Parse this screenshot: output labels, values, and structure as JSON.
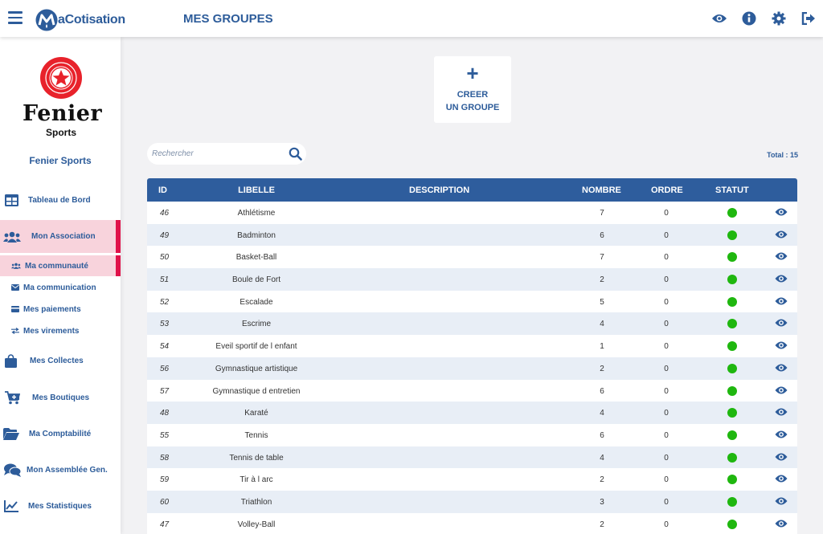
{
  "app": {
    "brand": "aCotisation",
    "brand_initial": "M"
  },
  "header": {
    "title": "MES GROUPES"
  },
  "org": {
    "name": "Fenier Sports",
    "logo_line1": "Fenier",
    "logo_line2": "Sports"
  },
  "sidebar": {
    "items": [
      {
        "label": "Tableau de Bord"
      },
      {
        "label": "Mon Association"
      },
      {
        "label": "Ma communauté"
      },
      {
        "label": "Ma communication"
      },
      {
        "label": "Mes paiements"
      },
      {
        "label": "Mes virements"
      },
      {
        "label": "Mes Collectes"
      },
      {
        "label": "Mes Boutiques"
      },
      {
        "label": "Ma Comptabilité"
      },
      {
        "label": "Mon Assemblée Gen."
      },
      {
        "label": "Mes Statistiques"
      }
    ]
  },
  "create": {
    "plus": "+",
    "line1": "CREER",
    "line2": "UN GROUPE"
  },
  "search": {
    "placeholder": "Rechercher",
    "value": ""
  },
  "total": "Total : 15",
  "table": {
    "headers": {
      "id": "ID",
      "libelle": "LIBELLE",
      "description": "DESCRIPTION",
      "nombre": "NOMBRE",
      "ordre": "ORDRE",
      "statut": "STATUT"
    },
    "rows": [
      {
        "id": "46",
        "libelle": "Athlétisme",
        "nombre": "7",
        "ordre": "0"
      },
      {
        "id": "49",
        "libelle": "Badminton",
        "nombre": "6",
        "ordre": "0"
      },
      {
        "id": "50",
        "libelle": "Basket-Ball",
        "nombre": "7",
        "ordre": "0"
      },
      {
        "id": "51",
        "libelle": "Boule de Fort",
        "nombre": "2",
        "ordre": "0"
      },
      {
        "id": "52",
        "libelle": "Escalade",
        "nombre": "5",
        "ordre": "0"
      },
      {
        "id": "53",
        "libelle": "Escrime",
        "nombre": "4",
        "ordre": "0"
      },
      {
        "id": "54",
        "libelle": "Eveil sportif de l enfant",
        "nombre": "1",
        "ordre": "0"
      },
      {
        "id": "56",
        "libelle": "Gymnastique artistique",
        "nombre": "2",
        "ordre": "0"
      },
      {
        "id": "57",
        "libelle": "Gymnastique d entretien",
        "nombre": "6",
        "ordre": "0"
      },
      {
        "id": "48",
        "libelle": "Karaté",
        "nombre": "4",
        "ordre": "0"
      },
      {
        "id": "55",
        "libelle": "Tennis",
        "nombre": "6",
        "ordre": "0"
      },
      {
        "id": "58",
        "libelle": "Tennis de table",
        "nombre": "4",
        "ordre": "0"
      },
      {
        "id": "59",
        "libelle": "Tir à l arc",
        "nombre": "2",
        "ordre": "0"
      },
      {
        "id": "60",
        "libelle": "Triathlon",
        "nombre": "3",
        "ordre": "0"
      },
      {
        "id": "47",
        "libelle": "Volley-Ball",
        "nombre": "2",
        "ordre": "0"
      }
    ]
  },
  "colors": {
    "primary": "#2d5c9a",
    "active_bg": "#f8d3dc",
    "active_bar": "#e0124a",
    "status_ok": "#1fb70f",
    "logo_red": "#e8222b"
  },
  "icons": [
    "menu-icon",
    "eye-icon",
    "info-icon",
    "gear-icon",
    "logout-icon",
    "search-icon",
    "dashboard-icon",
    "users-icon",
    "envelope-icon",
    "card-icon",
    "transfer-icon",
    "bag-icon",
    "cart-icon",
    "folder-icon",
    "chat-icon",
    "chart-icon"
  ]
}
